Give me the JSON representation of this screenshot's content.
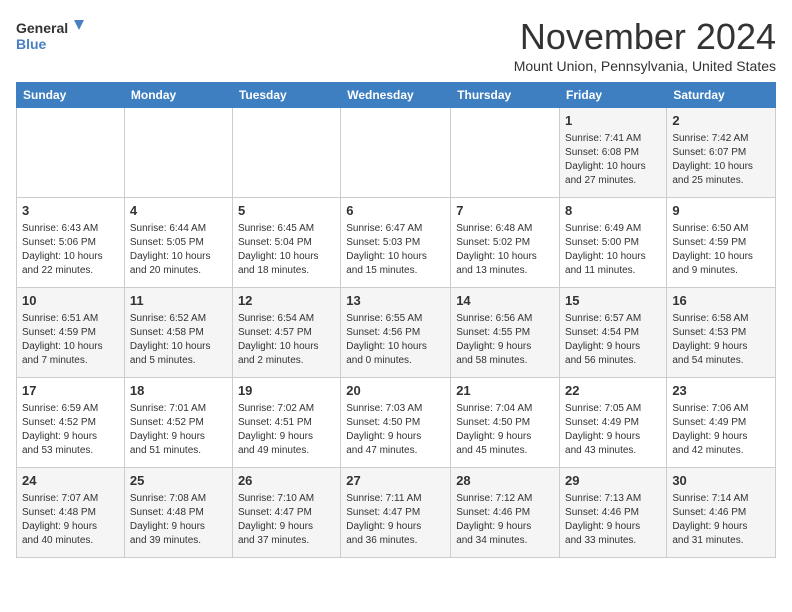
{
  "header": {
    "logo_line1": "General",
    "logo_line2": "Blue",
    "month": "November 2024",
    "location": "Mount Union, Pennsylvania, United States"
  },
  "weekdays": [
    "Sunday",
    "Monday",
    "Tuesday",
    "Wednesday",
    "Thursday",
    "Friday",
    "Saturday"
  ],
  "weeks": [
    [
      {
        "day": "",
        "info": ""
      },
      {
        "day": "",
        "info": ""
      },
      {
        "day": "",
        "info": ""
      },
      {
        "day": "",
        "info": ""
      },
      {
        "day": "",
        "info": ""
      },
      {
        "day": "1",
        "info": "Sunrise: 7:41 AM\nSunset: 6:08 PM\nDaylight: 10 hours\nand 27 minutes."
      },
      {
        "day": "2",
        "info": "Sunrise: 7:42 AM\nSunset: 6:07 PM\nDaylight: 10 hours\nand 25 minutes."
      }
    ],
    [
      {
        "day": "3",
        "info": "Sunrise: 6:43 AM\nSunset: 5:06 PM\nDaylight: 10 hours\nand 22 minutes."
      },
      {
        "day": "4",
        "info": "Sunrise: 6:44 AM\nSunset: 5:05 PM\nDaylight: 10 hours\nand 20 minutes."
      },
      {
        "day": "5",
        "info": "Sunrise: 6:45 AM\nSunset: 5:04 PM\nDaylight: 10 hours\nand 18 minutes."
      },
      {
        "day": "6",
        "info": "Sunrise: 6:47 AM\nSunset: 5:03 PM\nDaylight: 10 hours\nand 15 minutes."
      },
      {
        "day": "7",
        "info": "Sunrise: 6:48 AM\nSunset: 5:02 PM\nDaylight: 10 hours\nand 13 minutes."
      },
      {
        "day": "8",
        "info": "Sunrise: 6:49 AM\nSunset: 5:00 PM\nDaylight: 10 hours\nand 11 minutes."
      },
      {
        "day": "9",
        "info": "Sunrise: 6:50 AM\nSunset: 4:59 PM\nDaylight: 10 hours\nand 9 minutes."
      }
    ],
    [
      {
        "day": "10",
        "info": "Sunrise: 6:51 AM\nSunset: 4:59 PM\nDaylight: 10 hours\nand 7 minutes."
      },
      {
        "day": "11",
        "info": "Sunrise: 6:52 AM\nSunset: 4:58 PM\nDaylight: 10 hours\nand 5 minutes."
      },
      {
        "day": "12",
        "info": "Sunrise: 6:54 AM\nSunset: 4:57 PM\nDaylight: 10 hours\nand 2 minutes."
      },
      {
        "day": "13",
        "info": "Sunrise: 6:55 AM\nSunset: 4:56 PM\nDaylight: 10 hours\nand 0 minutes."
      },
      {
        "day": "14",
        "info": "Sunrise: 6:56 AM\nSunset: 4:55 PM\nDaylight: 9 hours\nand 58 minutes."
      },
      {
        "day": "15",
        "info": "Sunrise: 6:57 AM\nSunset: 4:54 PM\nDaylight: 9 hours\nand 56 minutes."
      },
      {
        "day": "16",
        "info": "Sunrise: 6:58 AM\nSunset: 4:53 PM\nDaylight: 9 hours\nand 54 minutes."
      }
    ],
    [
      {
        "day": "17",
        "info": "Sunrise: 6:59 AM\nSunset: 4:52 PM\nDaylight: 9 hours\nand 53 minutes."
      },
      {
        "day": "18",
        "info": "Sunrise: 7:01 AM\nSunset: 4:52 PM\nDaylight: 9 hours\nand 51 minutes."
      },
      {
        "day": "19",
        "info": "Sunrise: 7:02 AM\nSunset: 4:51 PM\nDaylight: 9 hours\nand 49 minutes."
      },
      {
        "day": "20",
        "info": "Sunrise: 7:03 AM\nSunset: 4:50 PM\nDaylight: 9 hours\nand 47 minutes."
      },
      {
        "day": "21",
        "info": "Sunrise: 7:04 AM\nSunset: 4:50 PM\nDaylight: 9 hours\nand 45 minutes."
      },
      {
        "day": "22",
        "info": "Sunrise: 7:05 AM\nSunset: 4:49 PM\nDaylight: 9 hours\nand 43 minutes."
      },
      {
        "day": "23",
        "info": "Sunrise: 7:06 AM\nSunset: 4:49 PM\nDaylight: 9 hours\nand 42 minutes."
      }
    ],
    [
      {
        "day": "24",
        "info": "Sunrise: 7:07 AM\nSunset: 4:48 PM\nDaylight: 9 hours\nand 40 minutes."
      },
      {
        "day": "25",
        "info": "Sunrise: 7:08 AM\nSunset: 4:48 PM\nDaylight: 9 hours\nand 39 minutes."
      },
      {
        "day": "26",
        "info": "Sunrise: 7:10 AM\nSunset: 4:47 PM\nDaylight: 9 hours\nand 37 minutes."
      },
      {
        "day": "27",
        "info": "Sunrise: 7:11 AM\nSunset: 4:47 PM\nDaylight: 9 hours\nand 36 minutes."
      },
      {
        "day": "28",
        "info": "Sunrise: 7:12 AM\nSunset: 4:46 PM\nDaylight: 9 hours\nand 34 minutes."
      },
      {
        "day": "29",
        "info": "Sunrise: 7:13 AM\nSunset: 4:46 PM\nDaylight: 9 hours\nand 33 minutes."
      },
      {
        "day": "30",
        "info": "Sunrise: 7:14 AM\nSunset: 4:46 PM\nDaylight: 9 hours\nand 31 minutes."
      }
    ]
  ]
}
